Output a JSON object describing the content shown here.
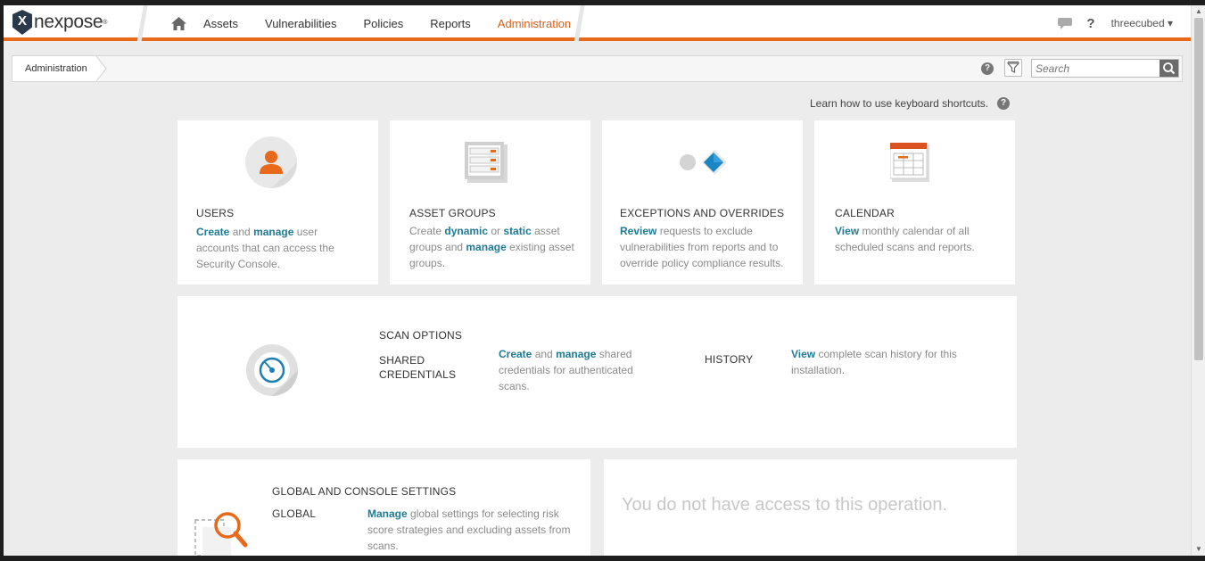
{
  "app": {
    "name": "nexpose"
  },
  "nav": {
    "items": [
      "Assets",
      "Vulnerabilities",
      "Policies",
      "Reports",
      "Administration"
    ],
    "active": "Administration"
  },
  "user": {
    "name": "threecubed ▾"
  },
  "breadcrumb": {
    "current": "Administration"
  },
  "search": {
    "placeholder": "Search"
  },
  "keyboard_help": "Learn how to use keyboard shortcuts.",
  "cards": {
    "users": {
      "title": "USERS",
      "w1": "Create",
      "t1": " and ",
      "w2": "manage",
      "t2": " user accounts that can access the Security Console."
    },
    "asset_groups": {
      "title": "ASSET GROUPS",
      "t0": "Create ",
      "w1": "dynamic",
      "t1": " or ",
      "w2": "static",
      "t2": " asset groups and ",
      "w3": "manage",
      "t3": " existing asset groups."
    },
    "exceptions": {
      "title": "EXCEPTIONS AND OVERRIDES",
      "w1": "Review",
      "t1": " requests to exclude vulnerabilities from reports and to override policy compliance results."
    },
    "calendar": {
      "title": "CALENDAR",
      "w1": "View",
      "t1": " monthly calendar of all scheduled scans and reports."
    }
  },
  "scan_options": {
    "title": "SCAN OPTIONS",
    "shared_label": "SHARED CREDENTIALS",
    "shared": {
      "w1": "Create",
      "t1": " and ",
      "w2": "manage",
      "t2": " shared credentials for authenticated scans."
    },
    "history_label": "HISTORY",
    "history": {
      "w1": "View",
      "t1": " complete scan history for this installation."
    }
  },
  "global_settings": {
    "title": "GLOBAL AND CONSOLE SETTINGS",
    "global_label": "GLOBAL",
    "global": {
      "w1": "Manage",
      "t1": " global settings for selecting risk score strategies and excluding assets from scans."
    }
  },
  "no_access": "You do not have access to this operation.",
  "colors": {
    "accent": "#e8691a",
    "link": "#1f7a94",
    "muted": "#8a8a8a"
  }
}
